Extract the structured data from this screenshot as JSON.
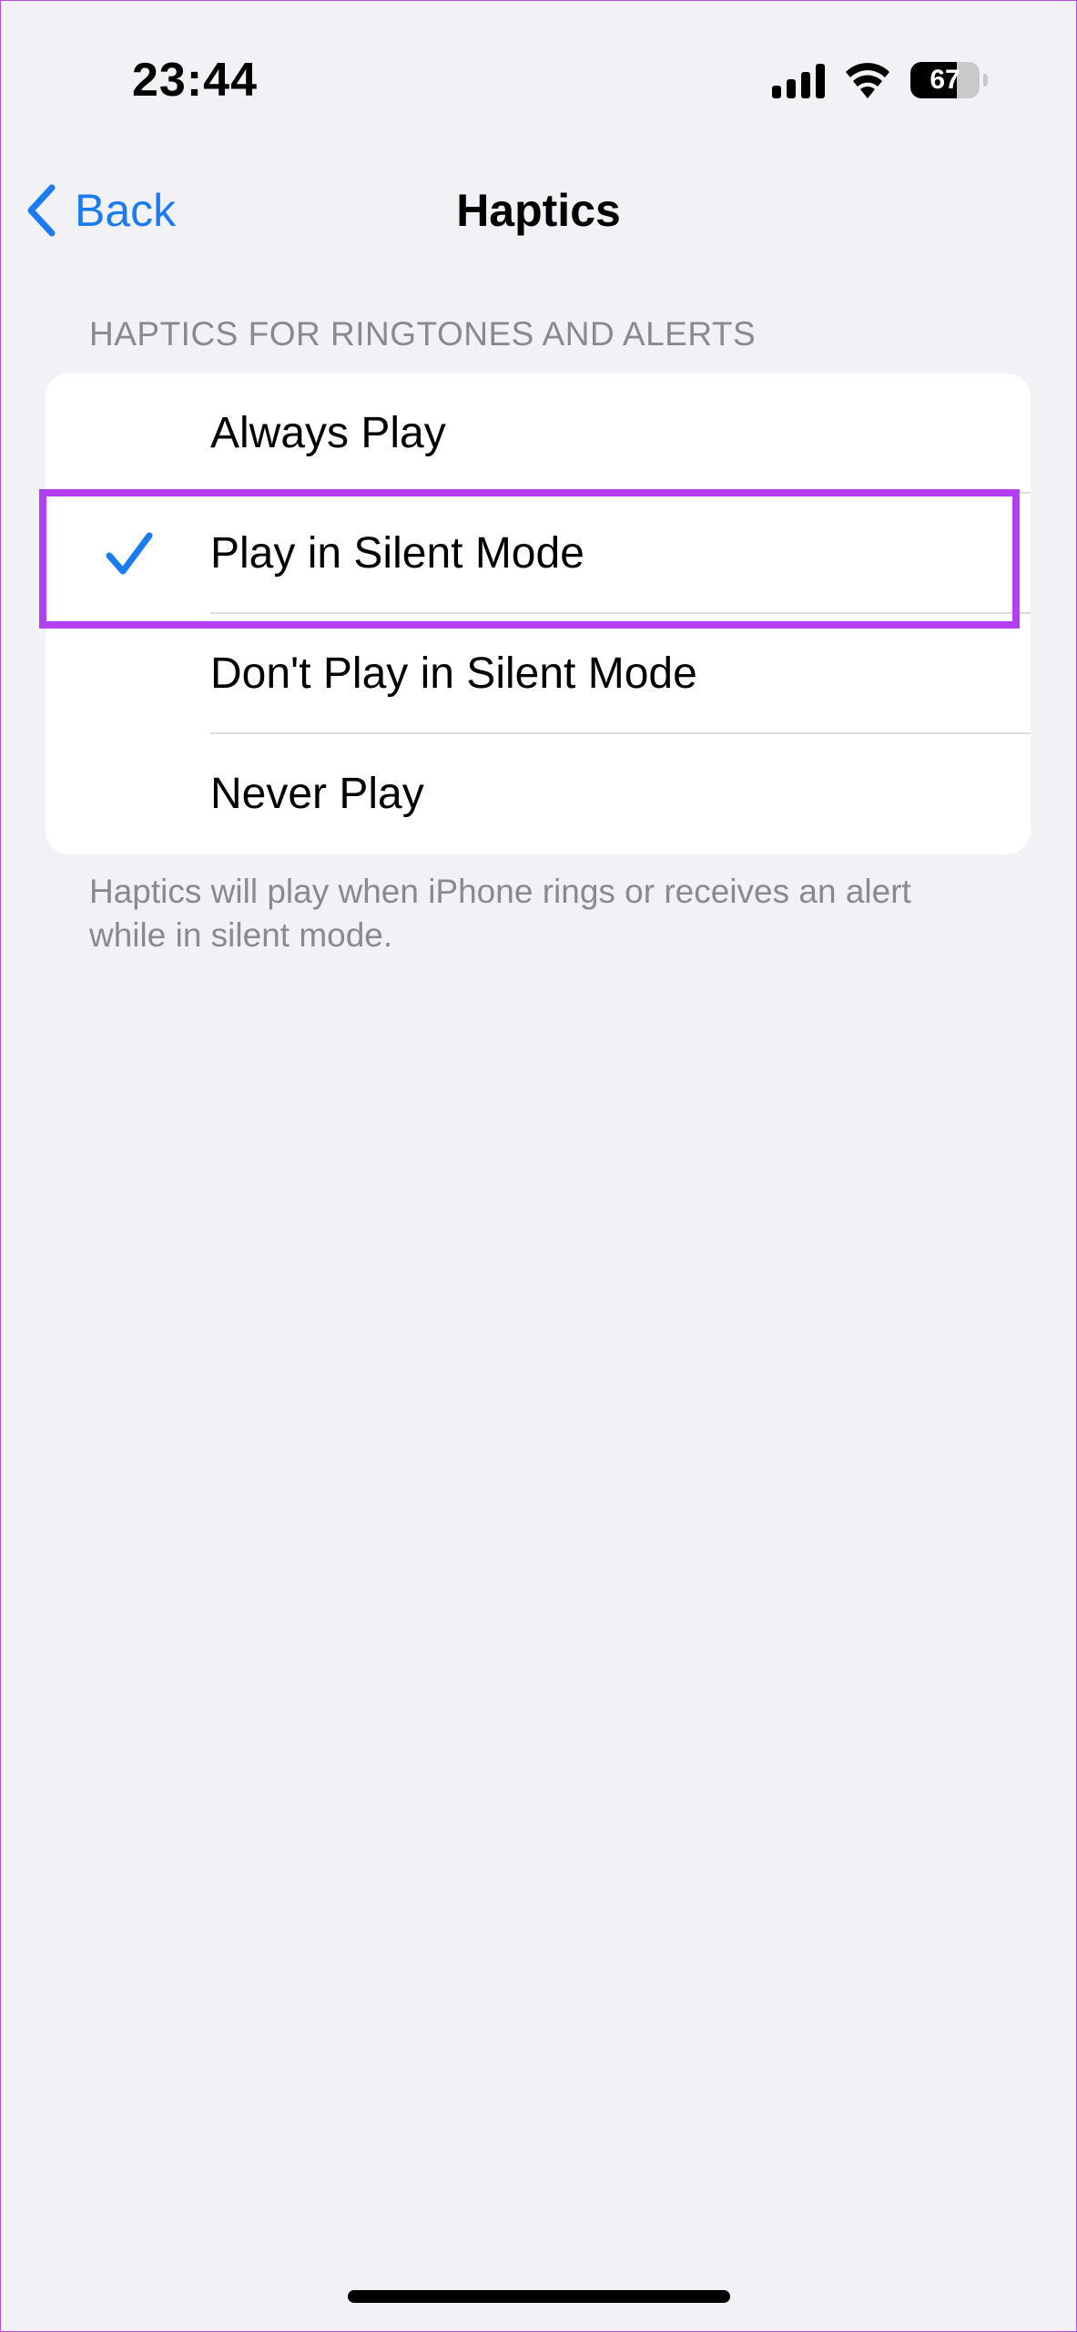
{
  "status_bar": {
    "time": "23:44",
    "battery_level": "67",
    "battery_fraction": 0.67
  },
  "nav": {
    "back_label": "Back",
    "title": "Haptics"
  },
  "section": {
    "header": "HAPTICS FOR RINGTONES AND ALERTS",
    "options": [
      {
        "label": "Always Play",
        "selected": false
      },
      {
        "label": "Play in Silent Mode",
        "selected": true
      },
      {
        "label": "Don't Play in Silent Mode",
        "selected": false
      },
      {
        "label": "Never Play",
        "selected": false
      }
    ],
    "footer": "Haptics will play when iPhone rings or receives an alert while in silent mode."
  },
  "colors": {
    "accent": "#1a7cf0",
    "highlight": "#b33ff0",
    "background": "#f2f1f6"
  },
  "icons": [
    "signal-icon",
    "wifi-icon",
    "battery-icon",
    "chevron-left-icon",
    "checkmark-icon"
  ]
}
